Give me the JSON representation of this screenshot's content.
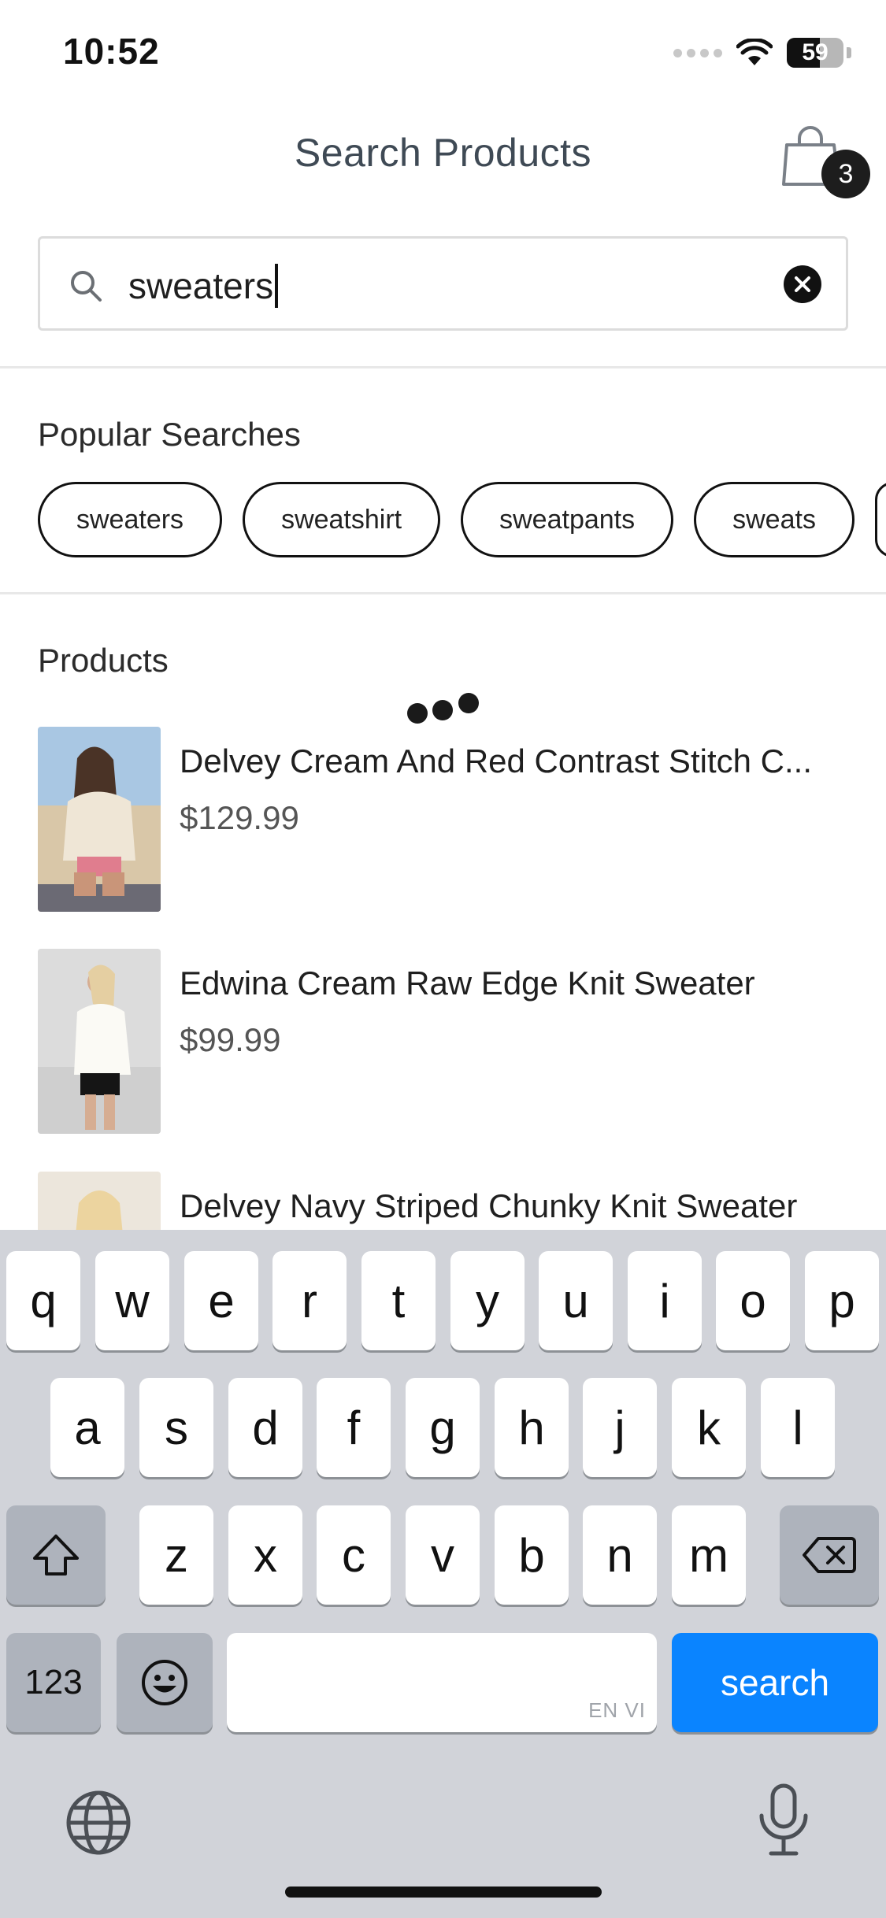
{
  "status_bar": {
    "time": "10:52",
    "battery_level": "59",
    "battery_percent": 59
  },
  "header": {
    "title": "Search Products",
    "cart_count": "3",
    "cart_icon": "shopping-bag-icon"
  },
  "search": {
    "value": "sweaters",
    "icon": "search-icon",
    "clear_icon": "clear-icon"
  },
  "popular": {
    "title": "Popular Searches",
    "chips": [
      "sweaters",
      "sweatshirt",
      "sweatpants",
      "sweats"
    ]
  },
  "products": {
    "title": "Products",
    "items": [
      {
        "name": "Delvey Cream And Red Contrast Stitch C...",
        "price": "$129.99"
      },
      {
        "name": "Edwina Cream Raw Edge Knit Sweater",
        "price": "$99.99"
      },
      {
        "name": "Delvey Navy Striped Chunky Knit Sweater",
        "price": ""
      }
    ]
  },
  "keyboard": {
    "row1": [
      "q",
      "w",
      "e",
      "r",
      "t",
      "y",
      "u",
      "i",
      "o",
      "p"
    ],
    "row2": [
      "a",
      "s",
      "d",
      "f",
      "g",
      "h",
      "j",
      "k",
      "l"
    ],
    "row3": [
      "z",
      "x",
      "c",
      "v",
      "b",
      "n",
      "m"
    ],
    "numbers_label": "123",
    "search_label": "search",
    "space_hint": "EN VI",
    "accent_color": "#0a84ff",
    "icons": {
      "shift": "shift-icon",
      "backspace": "backspace-icon",
      "emoji": "emoji-icon",
      "globe": "globe-icon",
      "mic": "microphone-icon"
    }
  }
}
